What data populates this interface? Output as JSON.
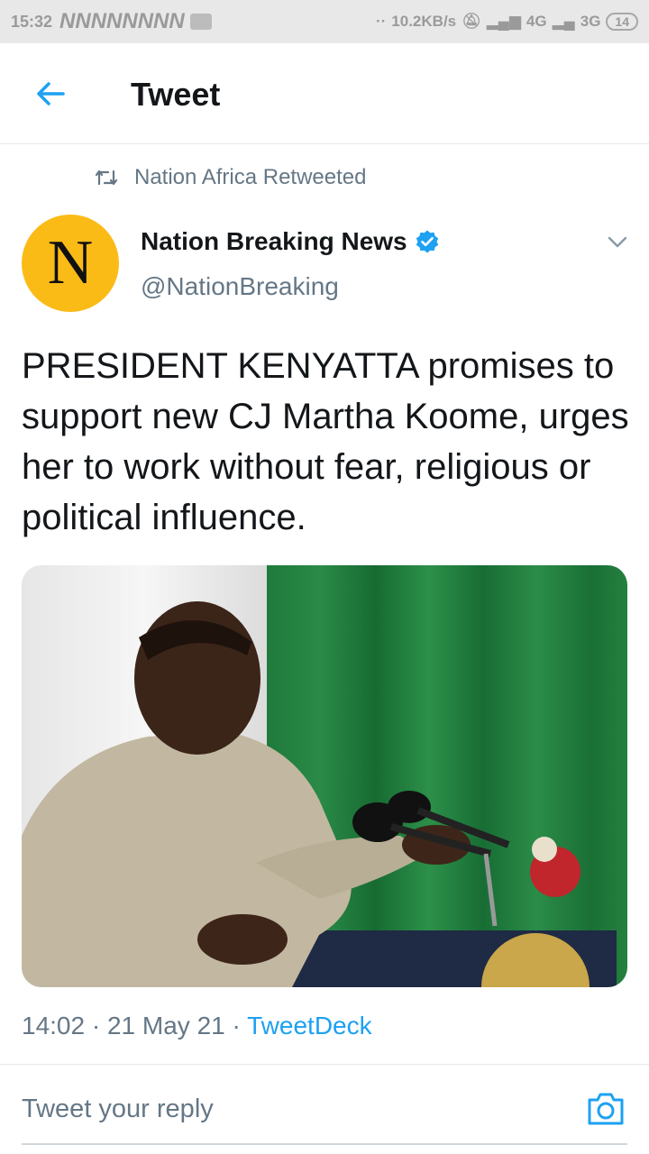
{
  "status_bar": {
    "time": "15:32",
    "notification_glyphs": "NNNNNNNN",
    "net_speed": "10.2KB/s",
    "network_1": "4G",
    "network_2": "3G",
    "battery": "14"
  },
  "header": {
    "title": "Tweet",
    "back_icon": "arrow-left-icon"
  },
  "tweet": {
    "retweet_label": "Nation Africa Retweeted",
    "author_name": "Nation Breaking News",
    "author_handle": "@NationBreaking",
    "avatar_letter": "N",
    "avatar_color": "#fbbb17",
    "verified": true,
    "text": "PRESIDENT KENYATTA promises to support new CJ Martha Koome, urges her to work without fear, religious or political influence.",
    "time": "14:02",
    "date": "21 May 21",
    "source": "TweetDeck"
  },
  "reply": {
    "placeholder": "Tweet your reply",
    "camera_icon": "camera-icon"
  },
  "colors": {
    "accent": "#1da1f2",
    "secondary_text": "#657786"
  }
}
